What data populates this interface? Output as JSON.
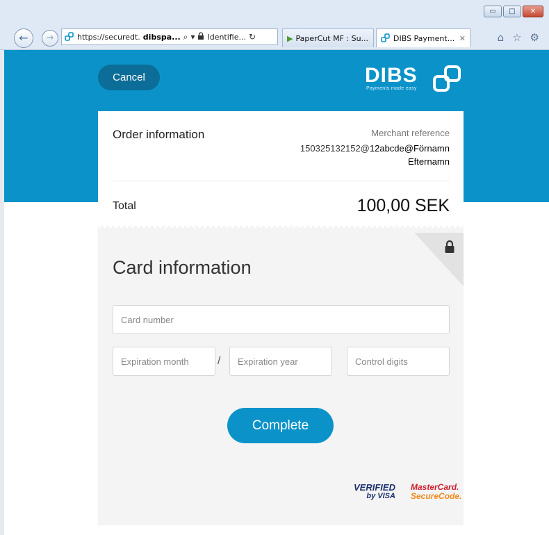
{
  "browser": {
    "window_controls": {
      "minimize": "▭",
      "maximize": "□",
      "close": "✕"
    },
    "nav_back_glyph": "←",
    "nav_forward_glyph": "→",
    "address": {
      "url_prefix": "https://securedt.",
      "url_host": "dibspa...",
      "search_glyph": "⌕",
      "dropdown_glyph": "▾",
      "identity": "Identifie...",
      "refresh_glyph": "↻"
    },
    "tabs": [
      {
        "label": "PaperCut MF : Su...",
        "active": false
      },
      {
        "label": "DIBS Payment...",
        "active": true,
        "close": "✕"
      }
    ],
    "toolbar_glyphs": {
      "home": "⌂",
      "favorites": "☆",
      "settings": "⚙"
    }
  },
  "page": {
    "cancel_label": "Cancel",
    "logo": {
      "word": "DIBS",
      "tagline": "Payments made easy"
    },
    "order": {
      "title": "Order information",
      "merchant_label": "Merchant reference",
      "merchant_ref_prefix": "150325132152@",
      "merchant_ref_name": "12abcde@Förnamn",
      "merchant_ref_name2": "Efternamn",
      "total_label": "Total",
      "total_amount": "100,00 SEK"
    },
    "card": {
      "title": "Card information",
      "card_number_placeholder": "Card number",
      "exp_month_placeholder": "Expiration month",
      "exp_year_placeholder": "Expiration year",
      "control_digits_placeholder": "Control digits",
      "separator": "/",
      "complete_label": "Complete"
    },
    "badges": {
      "visa_line1": "VERIFIED",
      "visa_line2": "by VISA",
      "mc_line1": "MasterCard.",
      "mc_line2": "SecureCode."
    }
  },
  "colors": {
    "brand_blue": "#0b93c9",
    "cancel_blue": "#0b6d98",
    "panel_gray": "#f4f4f4"
  }
}
